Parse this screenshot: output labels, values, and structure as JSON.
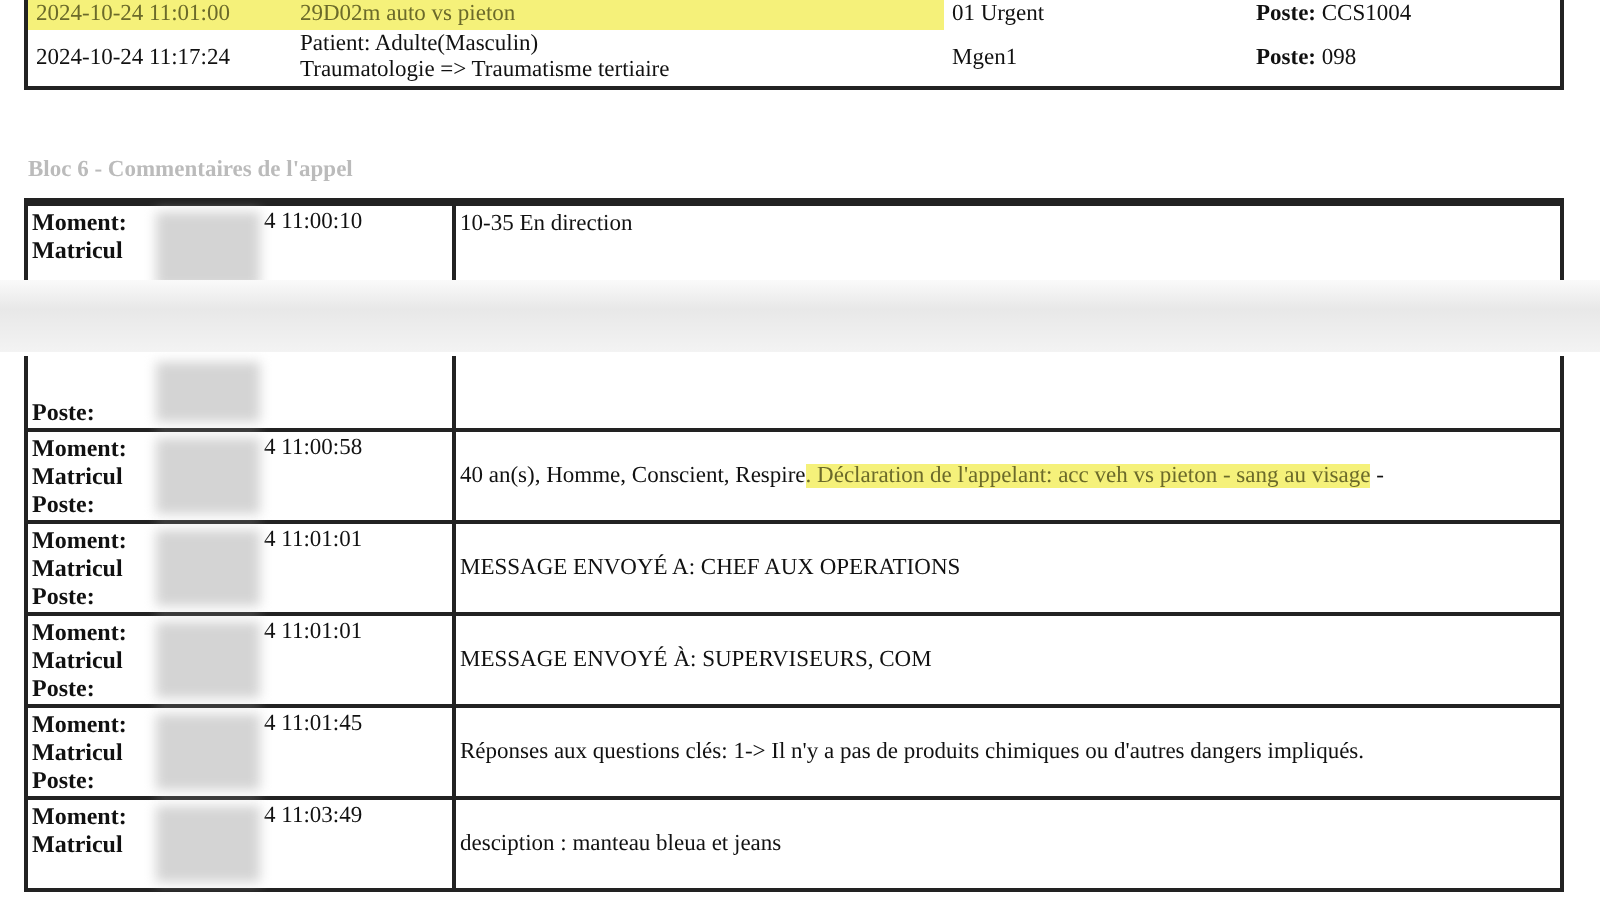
{
  "top_table": {
    "rows": [
      {
        "time": "2024-10-24 11:01:00",
        "description": [
          "29D02m auto vs pieton"
        ],
        "highlighted": true,
        "column_3": "01 Urgent",
        "poste_label": "Poste:",
        "poste_value": "CCS1004"
      },
      {
        "time": "2024-10-24 11:17:24",
        "description": [
          "Patient: Adulte(Masculin)",
          "Traumatologie => Traumatisme tertiaire"
        ],
        "highlighted": false,
        "column_3": "Mgen1",
        "poste_label": "Poste:",
        "poste_value": "098"
      }
    ]
  },
  "section_heading": "Bloc 6 - Commentaires de l'appel",
  "pages": [
    {
      "entries": [
        {
          "labels": [
            "Moment:",
            "Matricul"
          ],
          "time": "4 11:00:10",
          "comment": [
            {
              "text": "10-35 En direction",
              "highlighted": false
            }
          ]
        }
      ]
    },
    {
      "entries": [
        {
          "labels": [
            "Poste:"
          ]
        },
        {
          "labels": [
            "Moment:",
            "Matricul",
            "Poste:"
          ],
          "time": "4 11:00:58",
          "comment": [
            {
              "text": "40 an(s), Homme, Conscient, Respire",
              "highlighted": false
            },
            {
              "text": ". Déclaration de l'appelant: acc veh vs pieton - sang au visage",
              "highlighted": true
            },
            {
              "text": " -",
              "highlighted": false
            }
          ]
        },
        {
          "labels": [
            "Moment:",
            "Matricul",
            "Poste:"
          ],
          "time": "4 11:01:01",
          "comment": [
            {
              "text": "MESSAGE ENVOYÉ A: CHEF AUX OPERATIONS",
              "highlighted": false
            }
          ]
        },
        {
          "labels": [
            "Moment:",
            "Matricul",
            "Poste:"
          ],
          "time": "4 11:01:01",
          "comment": [
            {
              "text": "MESSAGE ENVOYÉ À: SUPERVISEURS, COM",
              "highlighted": false
            }
          ]
        },
        {
          "labels": [
            "Moment:",
            "Matricul",
            "Poste:"
          ],
          "time": "4 11:01:45",
          "comment": [
            {
              "text": "Réponses aux questions clés: 1-> Il n'y a pas de produits chimiques ou d'autres dangers impliqués.",
              "highlighted": false
            }
          ]
        },
        {
          "labels": [
            "Moment:",
            "Matricul"
          ],
          "time": "4 11:03:49",
          "comment": [
            {
              "text": "desciption : manteau bleua et jeans",
              "highlighted": false
            }
          ]
        }
      ]
    }
  ]
}
